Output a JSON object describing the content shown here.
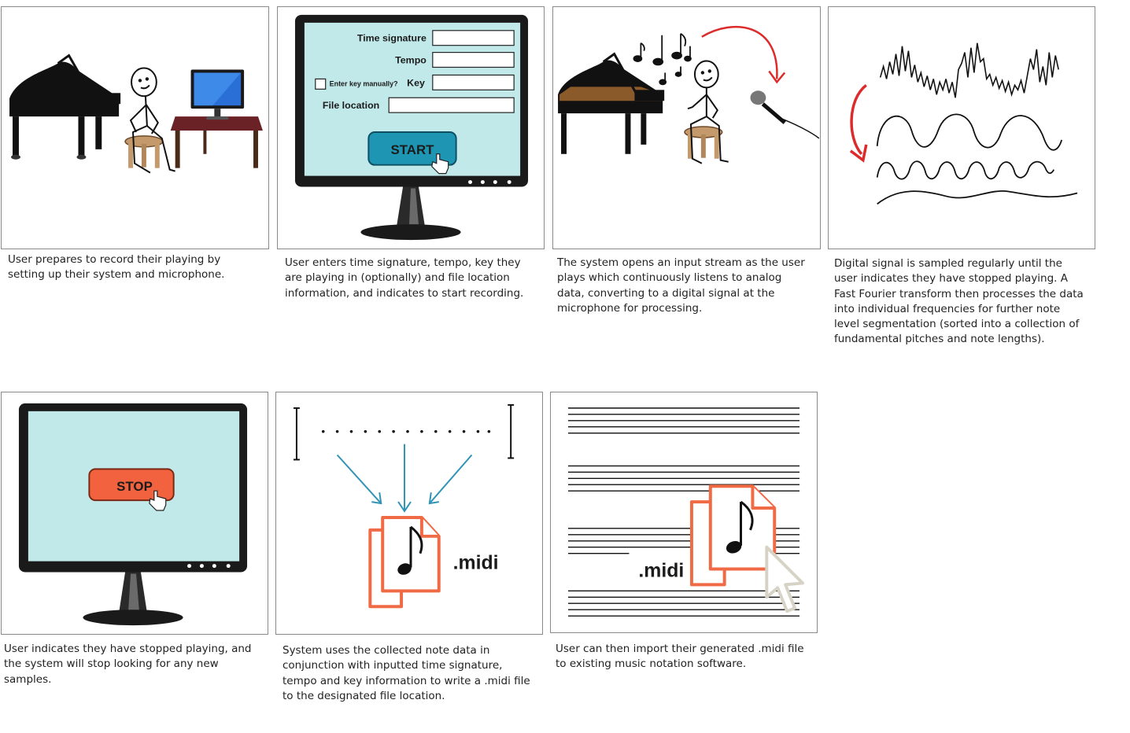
{
  "panels": [
    {
      "caption": "User prepares to record their playing by setting up their system and microphone."
    },
    {
      "caption": "User enters time signature, tempo, key they are playing in (optionally) and file location information, and indicates to start recording.",
      "form": {
        "time_signature_label": "Time signature",
        "tempo_label": "Tempo",
        "key_label": "Key",
        "enter_key_manually_label": "Enter key manually?",
        "file_location_label": "File location",
        "start_label": "START"
      }
    },
    {
      "caption": "The system opens an input stream as the user plays which continuously listens to analog data, converting to a digital signal at the microphone for processing."
    },
    {
      "caption": "Digital signal is sampled regularly until the user indicates they have stopped playing. A Fast Fourier transform then processes the data into individual frequencies for further note level segmentation (sorted into a collection of fundamental pitches and note lengths)."
    },
    {
      "caption": "User indicates they have stopped playing, and the system will stop looking for any new samples.",
      "stop_label": "STOP"
    },
    {
      "caption": "System uses the collected note data in conjunction with inputted time signature, tempo and key information to write a .midi file to the designated file location.",
      "file_ext": ".midi"
    },
    {
      "caption": "User can then import their generated .midi file to existing music notation software.",
      "file_ext": ".midi"
    }
  ],
  "colors": {
    "screen": "#c2e9ea",
    "start_button": "#1e95b3",
    "stop_button": "#f2623e",
    "file_icon": "#f06a45",
    "arrow_red": "#dd2a2a",
    "arrow_blue": "#2f93b6"
  }
}
